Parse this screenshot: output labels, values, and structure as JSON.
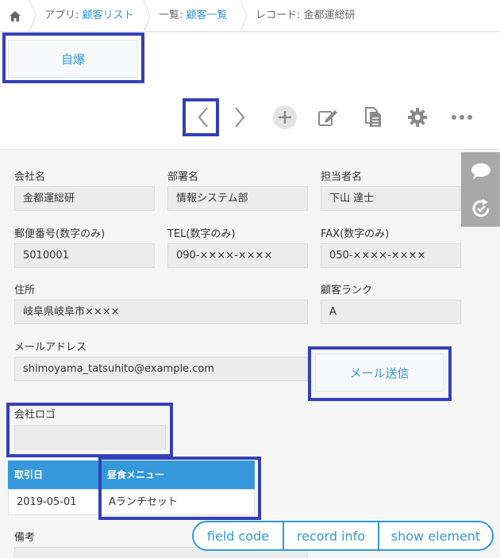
{
  "breadcrumb": {
    "home_icon": "home-icon",
    "app_prefix": "アプリ: ",
    "app_name": "顧客リスト",
    "view_prefix": "一覧: ",
    "view_name": "顧客一覧",
    "record": "レコード: 金都運総研"
  },
  "header": {
    "custom_button_label": "自爆"
  },
  "toolbar": {
    "icons": [
      "chevron-left-icon",
      "chevron-right-icon",
      "plus-icon",
      "edit-icon",
      "copy-icon",
      "gear-icon",
      "more-icon"
    ]
  },
  "fields": {
    "company": {
      "label": "会社名",
      "value": "金都運総研"
    },
    "department": {
      "label": "部署名",
      "value": "情報システム部"
    },
    "person": {
      "label": "担当者名",
      "value": "下山 達士"
    },
    "zip": {
      "label": "郵便番号(数字のみ)",
      "value": "5010001"
    },
    "tel": {
      "label": "TEL(数字のみ)",
      "value": "090-××××-××××"
    },
    "fax": {
      "label": "FAX(数字のみ)",
      "value": "050-××××-××××"
    },
    "address": {
      "label": "住所",
      "value": "岐阜県岐阜市××××"
    },
    "rank": {
      "label": "顧客ランク",
      "value": "A"
    },
    "email": {
      "label": "メールアドレス",
      "value": "shimoyama_tatsuhito@example.com"
    },
    "logo": {
      "label": "会社ロゴ",
      "value": ""
    },
    "notes": {
      "label": "備考"
    }
  },
  "mail_button_label": "メール送信",
  "table": {
    "headers": [
      "取引日",
      "昼食メニュー"
    ],
    "rows": [
      [
        "2019-05-01",
        "Aランチセット"
      ]
    ]
  },
  "side_panel": {
    "icons": [
      "comment-icon",
      "history-icon"
    ]
  },
  "devtools": {
    "field_code": "field code",
    "record_info": "record info",
    "show_element": "show element"
  },
  "colors": {
    "accent": "#3498db",
    "highlight": "#3340b8",
    "side_panel": "#a8a8a8"
  }
}
